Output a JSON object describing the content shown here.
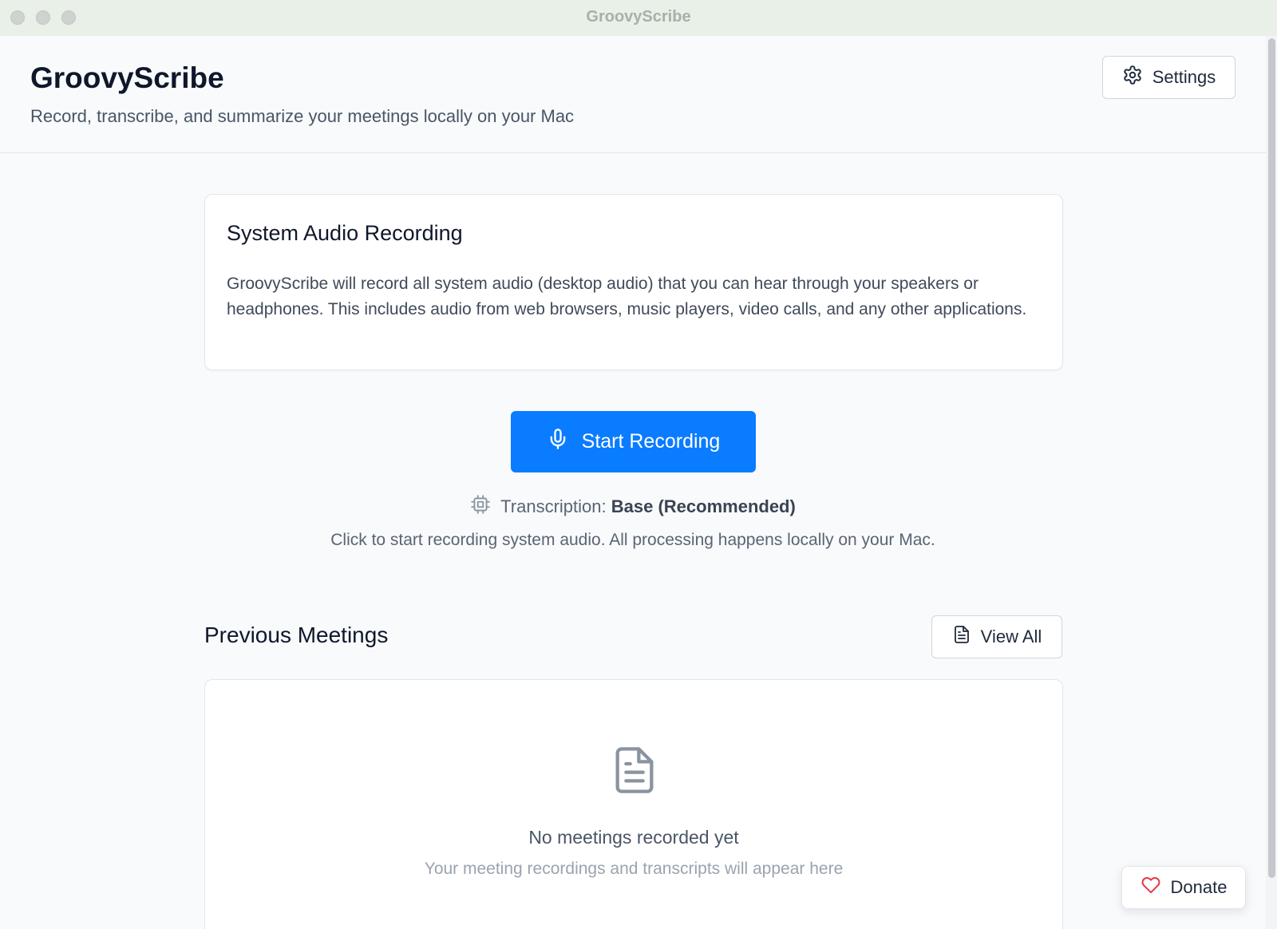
{
  "window": {
    "title": "GroovyScribe"
  },
  "header": {
    "title": "GroovyScribe",
    "subtitle": "Record, transcribe, and summarize your meetings locally on your Mac",
    "settings_label": "Settings",
    "settings_icon": "gear-icon"
  },
  "info_card": {
    "title": "System Audio Recording",
    "body": "GroovyScribe will record all system audio (desktop audio) that you can hear through your speakers or headphones. This includes audio from web browsers, music players, video calls, and any other applications."
  },
  "recording": {
    "button_label": "Start Recording",
    "button_icon": "microphone-icon",
    "model_label": "Transcription:",
    "model_value": "Base (Recommended)",
    "model_icon": "cpu-chip-icon",
    "hint": "Click to start recording system audio. All processing happens locally on your Mac."
  },
  "meetings": {
    "title": "Previous Meetings",
    "view_all_label": "View All",
    "view_all_icon": "document-icon",
    "empty_title": "No meetings recorded yet",
    "empty_subtitle": "Your meeting recordings and transcripts will appear here"
  },
  "donate": {
    "label": "Donate",
    "icon": "heart-icon"
  },
  "colors": {
    "accent": "#0a7cff",
    "heart": "#e53945",
    "title_bar": "#e8f0e8",
    "background": "#f8fafc"
  }
}
